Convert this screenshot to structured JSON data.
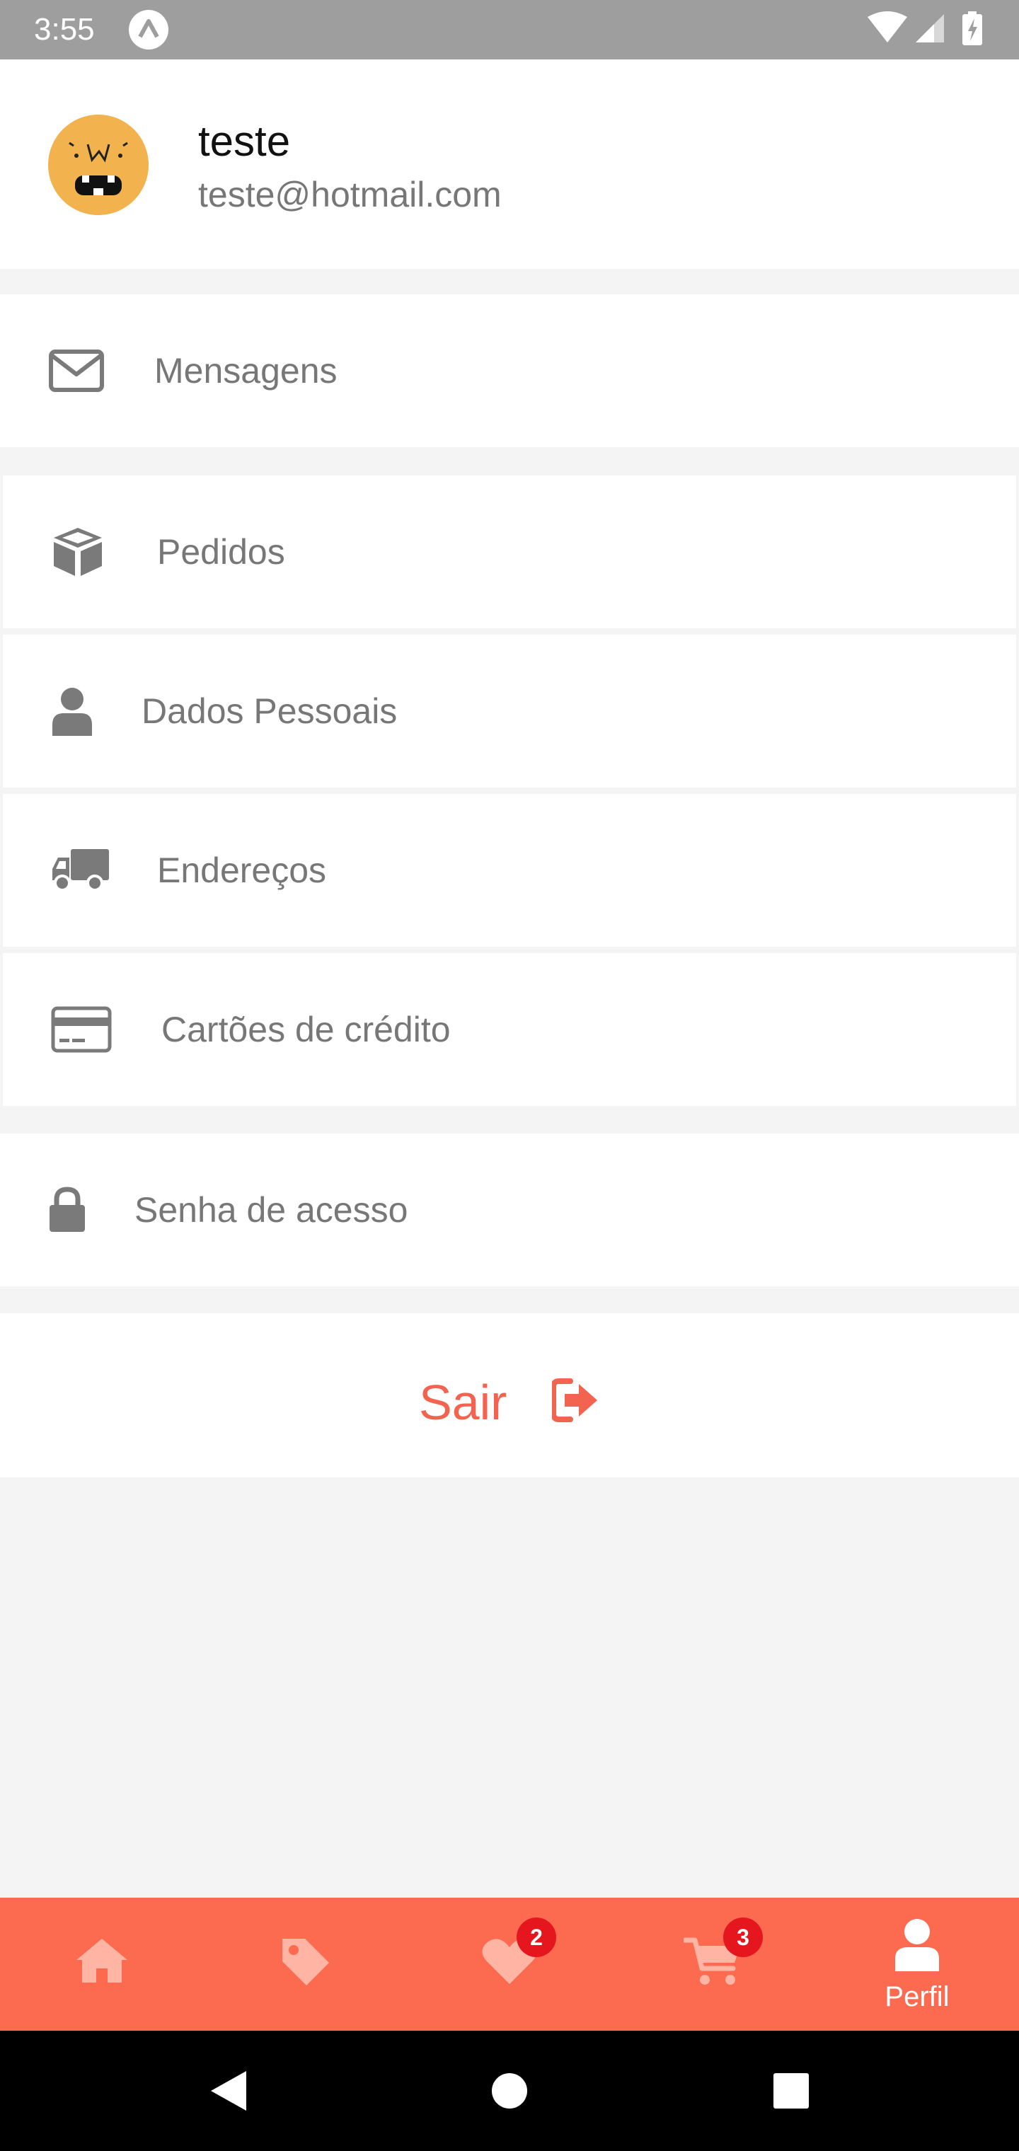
{
  "status_bar": {
    "time": "3:55",
    "app_icon": "caret-up-icon",
    "icons": [
      "wifi-icon",
      "signal-icon",
      "battery-charging-icon"
    ]
  },
  "profile": {
    "name": "teste",
    "email": "teste@hotmail.com",
    "avatar": "monster-avatar"
  },
  "menu": {
    "messages": {
      "label": "Mensagens",
      "icon": "envelope-icon"
    },
    "orders": {
      "label": "Pedidos",
      "icon": "box-icon"
    },
    "personal_data": {
      "label": "Dados Pessoais",
      "icon": "user-icon"
    },
    "addresses": {
      "label": "Endereços",
      "icon": "truck-icon"
    },
    "credit_cards": {
      "label": "Cartões de crédito",
      "icon": "credit-card-icon"
    },
    "password": {
      "label": "Senha de acesso",
      "icon": "lock-icon"
    }
  },
  "logout": {
    "label": "Sair",
    "icon": "sign-out-icon"
  },
  "bottom_nav": {
    "items": [
      {
        "id": "home",
        "icon": "home-icon",
        "label": ""
      },
      {
        "id": "offers",
        "icon": "tag-icon",
        "label": ""
      },
      {
        "id": "favorites",
        "icon": "heart-icon",
        "label": "",
        "badge": "2"
      },
      {
        "id": "cart",
        "icon": "cart-icon",
        "label": "",
        "badge": "3"
      },
      {
        "id": "profile",
        "icon": "user-icon",
        "label": "Perfil",
        "active": true
      }
    ]
  },
  "colors": {
    "accent": "#fc6a50",
    "logout_text": "#f26450",
    "badge": "#e5161e",
    "status_bar": "#9e9e9e",
    "background": "#f4f4f4",
    "icon_gray": "#7a7a7a"
  }
}
